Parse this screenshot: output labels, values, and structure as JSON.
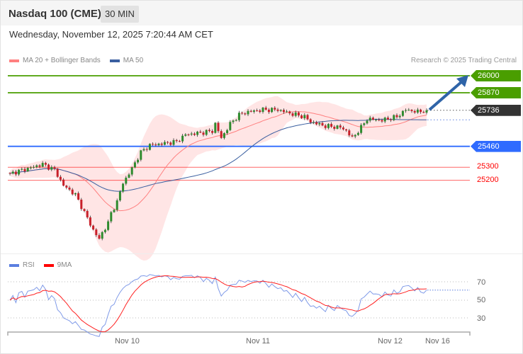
{
  "header": {
    "title": "Nasdaq 100 (CME)",
    "timeframe": "30 MIN"
  },
  "timestamp": "Wednesday, November 12, 2025 7:20:44 AM CET",
  "legend": {
    "ma20_bb": "MA 20 + Bollinger Bands",
    "ma50": "MA 50",
    "ma20_color": "#ff8080",
    "ma50_color": "#3a5fa0"
  },
  "credit": "Research © 2025 Trading Central",
  "levels": [
    {
      "label": "26000",
      "value": 26000,
      "kind": "target",
      "color": "#4a9e00"
    },
    {
      "label": "25870",
      "value": 25870,
      "kind": "target",
      "color": "#4a9e00"
    },
    {
      "label": "25736",
      "value": 25736,
      "kind": "last",
      "color": "#333333"
    },
    {
      "label": "25460",
      "value": 25460,
      "kind": "pivot",
      "color": "#2f6bff"
    },
    {
      "label": "25300",
      "value": 25300,
      "kind": "support",
      "color": "#ff0000"
    },
    {
      "label": "25200",
      "value": 25200,
      "kind": "support",
      "color": "#ff0000"
    }
  ],
  "rsi_panel": {
    "rsi_label": "RSI",
    "ma_label": "9MA",
    "rsi_color": "#5b7fe0",
    "ma_color": "#ff0000",
    "ticks": [
      "70",
      "50",
      "30"
    ]
  },
  "x_axis": {
    "labels": [
      "Nov 10",
      "Nov 11",
      "Nov 12",
      "Nov 16"
    ]
  },
  "chart_data": {
    "type": "candlestick",
    "interval": "30 MIN",
    "price_path": [
      [
        0,
        25252
      ],
      [
        6,
        25290
      ],
      [
        11,
        25323
      ],
      [
        15,
        25280
      ],
      [
        18,
        25160
      ],
      [
        22,
        25090
      ],
      [
        25,
        24955
      ],
      [
        28,
        24819
      ],
      [
        30,
        24749
      ],
      [
        31,
        24800
      ],
      [
        33,
        24873
      ],
      [
        34,
        24950
      ],
      [
        36,
        25036
      ],
      [
        38,
        25182
      ],
      [
        40,
        25250
      ],
      [
        42,
        25334
      ],
      [
        44,
        25415
      ],
      [
        47,
        25469
      ],
      [
        51,
        25480
      ],
      [
        56,
        25496
      ],
      [
        59,
        25550
      ],
      [
        63,
        25560
      ],
      [
        68,
        25577
      ],
      [
        69,
        25632
      ],
      [
        71,
        25523
      ],
      [
        74,
        25632
      ],
      [
        77,
        25702
      ],
      [
        80,
        25724
      ],
      [
        85,
        25740
      ],
      [
        90,
        25740
      ],
      [
        94,
        25713
      ],
      [
        99,
        25686
      ],
      [
        101,
        25648
      ],
      [
        106,
        25615
      ],
      [
        111,
        25605
      ],
      [
        113,
        25580
      ],
      [
        115,
        25523
      ],
      [
        118,
        25605
      ],
      [
        120,
        25670
      ],
      [
        125,
        25659
      ],
      [
        130,
        25686
      ],
      [
        133,
        25740
      ],
      [
        137,
        25724
      ],
      [
        140,
        25736
      ]
    ],
    "indicators": [
      "MA 20",
      "Bollinger Bands",
      "MA 50",
      "RSI",
      "9MA"
    ]
  }
}
